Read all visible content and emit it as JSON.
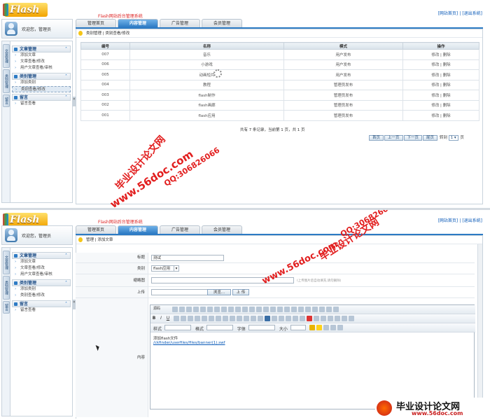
{
  "logo_text": "Flash",
  "system_title": "Flash网站后台管理系统",
  "toplinks": {
    "home": "[网站首页]",
    "logout": "[退出系统]",
    "sep": "|"
  },
  "welcome": "欢迎您，管理员",
  "tabs": [
    "管理首页",
    "内容管理",
    "广告管理",
    "会员管理"
  ],
  "vtabs": [
    "文章管理",
    "类别管理",
    "留言"
  ],
  "sidebar": {
    "groups": [
      {
        "title": "文章管理",
        "items": [
          "添加文章",
          "文章查看/修改",
          "用户文章查看/审核"
        ]
      },
      {
        "title": "类别管理",
        "items": [
          "添加类别",
          "类别查看/修改"
        ]
      },
      {
        "title": "留言",
        "items": [
          "留言查看"
        ]
      }
    ],
    "collapse_glyph": "«"
  },
  "top_panel": {
    "breadcrumb": "类别管理 | 类别查看/修改",
    "table": {
      "columns": [
        "编号",
        "名称",
        "模式",
        "操作"
      ],
      "rows": [
        [
          "007",
          "音乐",
          "用户发布",
          "修改 | 删除"
        ],
        [
          "006",
          "小游戏",
          "用户发布",
          "修改 | 删除"
        ],
        [
          "005",
          "动画短片",
          "用户发布",
          "修改 | 删除"
        ],
        [
          "004",
          "教程",
          "管理员发布",
          "修改 | 删除"
        ],
        [
          "003",
          "flash制作",
          "管理员发布",
          "修改 | 删除"
        ],
        [
          "002",
          "flash画廊",
          "管理员发布",
          "修改 | 删除"
        ],
        [
          "001",
          "flash应用",
          "管理员发布",
          "修改 | 删除"
        ]
      ]
    },
    "summary": "共有 7 条记录，当前第 1 页，共 1 页",
    "pager": [
      "首页",
      "上一页",
      "下一页",
      "尾页"
    ],
    "goto_label": "转到",
    "goto_value": "1",
    "page_unit": "页"
  },
  "bottom_panel": {
    "breadcrumb": "管理 | 添加文章",
    "form": {
      "title_label": "标题",
      "title_value": "测试",
      "category_label": "类别",
      "category_value": "flash应用",
      "thumb_label": "缩略图",
      "thumb_hint": "(上传图片后自动填充,请勿删除)",
      "upload_label": "上传",
      "browse_button": "浏览...",
      "upload_button": "上 传",
      "content_label": "内容"
    },
    "editor": {
      "source_button": "源码",
      "style_label": "样式",
      "format_label": "格式",
      "font_label": "字体",
      "size_label": "大小",
      "bold": "B",
      "italic": "I",
      "underline": "U",
      "body_line1": "添加flash文件",
      "body_line2": "/ckfinder/userfiles/files/banner(1).swf"
    }
  },
  "watermarks": {
    "site": "www.56doc.com",
    "qq": "QQ:306826066",
    "brand": "毕业设计论文网",
    "footer_brand": "毕业设计论文网",
    "footer_url": "www.56doc.com"
  }
}
